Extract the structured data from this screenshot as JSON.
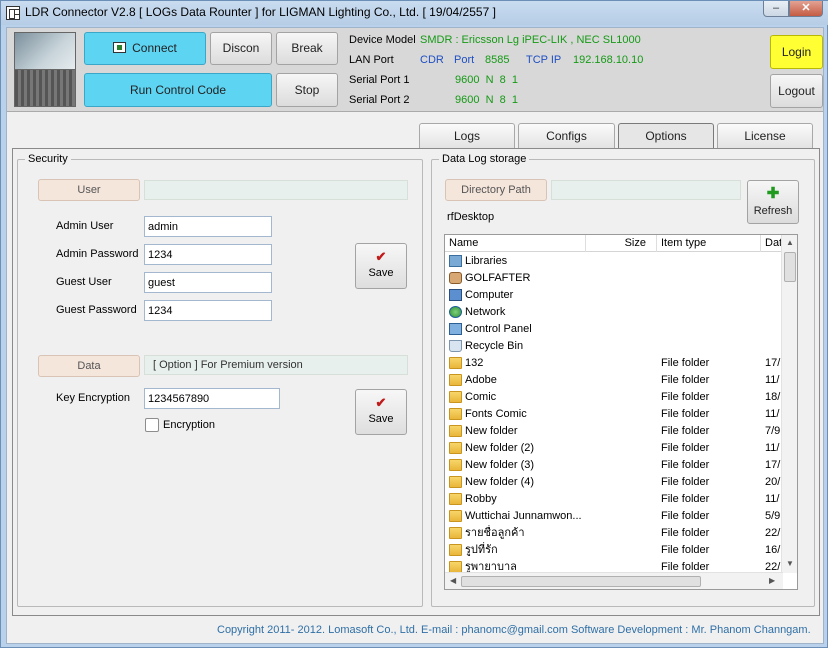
{
  "window": {
    "title": "LDR Connector V2.8 [ LOGs Data Rounter ] for LIGMAN Lighting Co., Ltd. [ 19/04/2557 ]",
    "minimize_label": "‒",
    "close_label": "✕"
  },
  "toolbar": {
    "connect_label": "Connect",
    "disconnect_label": "Discon",
    "break_label": "Break",
    "run_label": "Run Control Code",
    "stop_label": "Stop"
  },
  "device": {
    "model_label": "Device Model",
    "model_value": "SMDR : Ericsson Lg iPEC-LIK , NEC SL1000",
    "lan_label": "LAN Port",
    "lan_type": "CDR",
    "lan_port_label": "Port",
    "lan_port": "8585",
    "tcp_label": "TCP IP",
    "tcp_ip": "192.168.10.10",
    "serial1_label": "Serial Port  1",
    "serial1_value": "9600  N  8  1",
    "serial2_label": "Serial Port  2",
    "serial2_value": "9600  N  8  1"
  },
  "auth": {
    "login_label": "Login",
    "logout_label": "Logout"
  },
  "tabs": [
    "Logs",
    "Configs",
    "Options",
    "License"
  ],
  "security": {
    "title": "Security",
    "user_button": "User",
    "admin_user_label": "Admin User",
    "admin_user_value": "admin",
    "admin_pass_label": "Admin Password",
    "admin_pass_value": "1234",
    "guest_user_label": "Guest User",
    "guest_user_value": "guest",
    "guest_pass_label": "Guest Password",
    "guest_pass_value": "1234",
    "save_label": "Save",
    "data_button": "Data",
    "premium_note": "[ Option ] For Premium version",
    "key_label": "Key Encryption",
    "key_value": "1234567890",
    "encryption_label": "Encryption",
    "save2_label": "Save"
  },
  "storage": {
    "title": "Data Log storage",
    "dir_button": "Directory Path",
    "current_path": "rfDesktop",
    "refresh_label": "Refresh",
    "columns": [
      "Name",
      "Size",
      "Item type",
      "Dat"
    ],
    "rows": [
      {
        "icon": "libraries-icon",
        "name": "Libraries",
        "size": "",
        "type": "",
        "date": ""
      },
      {
        "icon": "user-folder-icon",
        "name": "GOLFAFTER",
        "size": "",
        "type": "",
        "date": ""
      },
      {
        "icon": "computer-icon",
        "name": "Computer",
        "size": "",
        "type": "",
        "date": ""
      },
      {
        "icon": "network-icon",
        "name": "Network",
        "size": "",
        "type": "",
        "date": ""
      },
      {
        "icon": "control-panel-icon",
        "name": "Control Panel",
        "size": "",
        "type": "",
        "date": ""
      },
      {
        "icon": "recycle-bin-icon",
        "name": "Recycle Bin",
        "size": "",
        "type": "",
        "date": ""
      },
      {
        "icon": "folder-icon",
        "name": "132",
        "size": "",
        "type": "File folder",
        "date": "17/"
      },
      {
        "icon": "folder-icon",
        "name": "Adobe",
        "size": "",
        "type": "File folder",
        "date": "11/"
      },
      {
        "icon": "folder-icon",
        "name": "Comic",
        "size": "",
        "type": "File folder",
        "date": "18/"
      },
      {
        "icon": "folder-icon",
        "name": "Fonts Comic",
        "size": "",
        "type": "File folder",
        "date": "11/"
      },
      {
        "icon": "folder-icon",
        "name": "New folder",
        "size": "",
        "type": "File folder",
        "date": "7/9"
      },
      {
        "icon": "folder-icon",
        "name": "New folder (2)",
        "size": "",
        "type": "File folder",
        "date": "11/"
      },
      {
        "icon": "folder-icon",
        "name": "New folder (3)",
        "size": "",
        "type": "File folder",
        "date": "17/"
      },
      {
        "icon": "folder-icon",
        "name": "New folder (4)",
        "size": "",
        "type": "File folder",
        "date": "20/"
      },
      {
        "icon": "folder-icon",
        "name": "Robby",
        "size": "",
        "type": "File folder",
        "date": "11/"
      },
      {
        "icon": "folder-icon",
        "name": "Wuttichai Junnamwon...",
        "size": "",
        "type": "File folder",
        "date": "5/9"
      },
      {
        "icon": "folder-icon",
        "name": "รายชื่อลูกค้า",
        "size": "",
        "type": "File folder",
        "date": "22/"
      },
      {
        "icon": "folder-icon",
        "name": "รูปที่รัก",
        "size": "",
        "type": "File folder",
        "date": "16/"
      },
      {
        "icon": "folder-icon",
        "name": "รูพายาบาล",
        "size": "",
        "type": "File folder",
        "date": "22/"
      }
    ]
  },
  "footer": {
    "text": "Copyright 2011- 2012. Lomasoft Co., Ltd.   E-mail : phanomc@gmail.com    Software Development  :  Mr. Phanom Channgam."
  }
}
